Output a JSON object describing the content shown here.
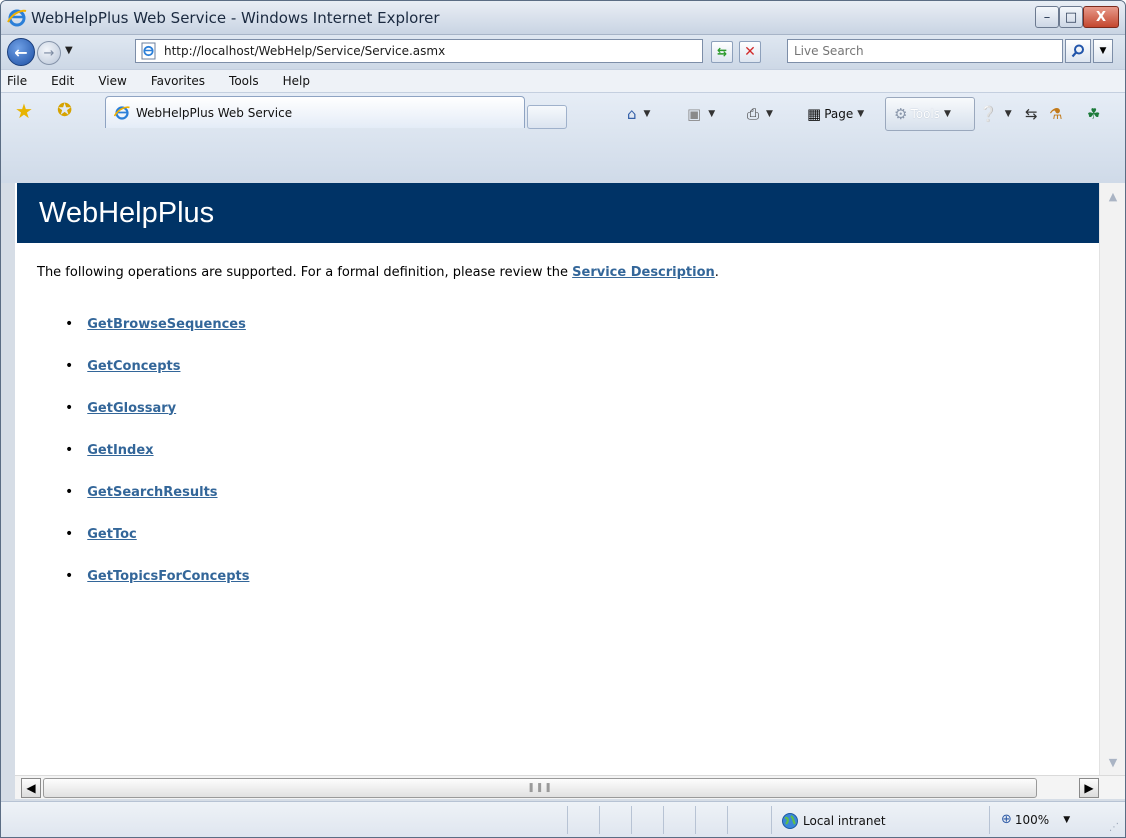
{
  "window": {
    "title": "WebHelpPlus Web Service - Windows Internet Explorer",
    "min_label": "–",
    "max_label": "□",
    "close_label": "X"
  },
  "address_bar": {
    "url": "http://localhost/WebHelp/Service/Service.asmx",
    "search_placeholder": "Live Search"
  },
  "menu": [
    "File",
    "Edit",
    "View",
    "Favorites",
    "Tools",
    "Help"
  ],
  "tab": {
    "label": "WebHelpPlus Web Service"
  },
  "command_bar": {
    "page_label": "Page",
    "tools_label": "Tools"
  },
  "page": {
    "heading": "WebHelpPlus",
    "intro_prefix": "The following operations are supported. For a formal definition, please review the ",
    "intro_link": "Service Description",
    "intro_suffix": ".",
    "operations": [
      "GetBrowseSequences",
      "GetConcepts",
      "GetGlossary",
      "GetIndex",
      "GetSearchResults",
      "GetToc",
      "GetTopicsForConcepts"
    ]
  },
  "status_bar": {
    "zone": "Local intranet",
    "zoom": "100%"
  },
  "colors": {
    "banner": "#003366",
    "link": "#336699"
  }
}
